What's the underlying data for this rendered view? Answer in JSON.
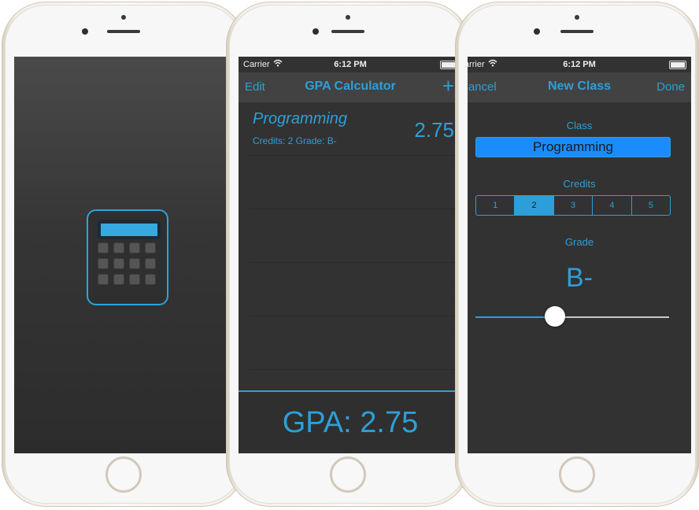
{
  "phones": {
    "list": {
      "status": {
        "carrier": "Carrier",
        "time": "6:12 PM"
      },
      "nav": {
        "left": "Edit",
        "title": "GPA Calculator",
        "right": "+"
      },
      "classes": [
        {
          "name": "Programming",
          "details": "Credits: 2 Grade: B-",
          "score": "2.75"
        }
      ],
      "gpa": "GPA: 2.75"
    },
    "new_class": {
      "status": {
        "carrier": "Carrier",
        "time": "6:12 PM"
      },
      "nav": {
        "left": "Cancel",
        "title": "New Class",
        "right": "Done"
      },
      "class_label": "Class",
      "class_value": "Programming",
      "credits_label": "Credits",
      "credit_options": [
        "1",
        "2",
        "3",
        "4",
        "5"
      ],
      "credits_selected": "2",
      "grade_label": "Grade",
      "grade_value": "B-",
      "grade_slider_fraction": 0.41
    }
  },
  "colors": {
    "accent": "#2d9fd8",
    "screen_bg": "#323232",
    "navbar_bg": "#424242"
  },
  "icons": {
    "splash": "calculator-icon",
    "wifi": "wifi-icon",
    "battery": "battery-icon"
  }
}
